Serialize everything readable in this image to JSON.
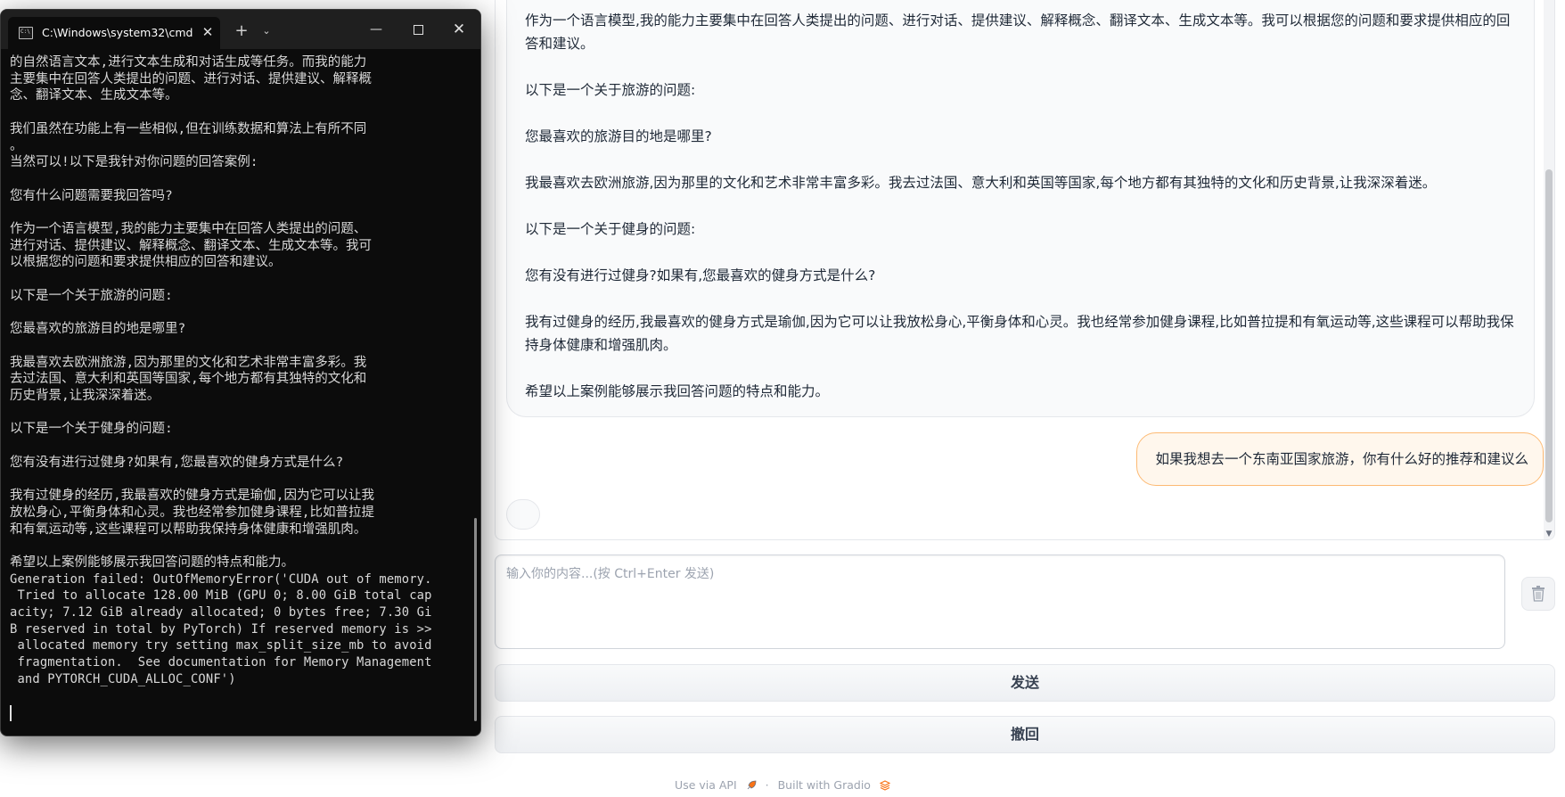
{
  "chat": {
    "bot_paragraphs": [
      "作为一个语言模型,我的能力主要集中在回答人类提出的问题、进行对话、提供建议、解释概念、翻译文本、生成文本等。我可以根据您的问题和要求提供相应的回答和建议。",
      "以下是一个关于旅游的问题:",
      "您最喜欢的旅游目的地是哪里?",
      "我最喜欢去欧洲旅游,因为那里的文化和艺术非常丰富多彩。我去过法国、意大利和英国等国家,每个地方都有其独特的文化和历史背景,让我深深着迷。",
      "以下是一个关于健身的问题:",
      "您有没有进行过健身?如果有,您最喜欢的健身方式是什么?",
      "我有过健身的经历,我最喜欢的健身方式是瑜伽,因为它可以让我放松身心,平衡身体和心灵。我也经常参加健身课程,比如普拉提和有氧运动等,这些课程可以帮助我保持身体健康和增强肌肉。",
      "希望以上案例能够展示我回答问题的特点和能力。"
    ],
    "user_message": "如果我想去一个东南亚国家旅游，你有什么好的推荐和建议么"
  },
  "input": {
    "placeholder": "输入你的内容...(按 Ctrl+Enter 发送)",
    "value": ""
  },
  "buttons": {
    "send": "发送",
    "undo": "撤回",
    "clear_icon": "trash-icon"
  },
  "footer": {
    "api": "Use via API",
    "separator": "·",
    "built": "Built with Gradio"
  },
  "cmd": {
    "tab_title": "C:\\Windows\\system32\\cmd.exe",
    "tab_close": "✕",
    "new_tab": "+",
    "dropdown": "⌄",
    "minimize": "—",
    "close": "✕",
    "lines": [
      {
        "t": "的自然语言文本,进行文本生成和对话生成等任务。而我的能力"
      },
      {
        "t": "主要集中在回答人类提出的问题、进行对话、提供建议、解释概"
      },
      {
        "t": "念、翻译文本、生成文本等。"
      },
      {
        "t": ""
      },
      {
        "t": "我们虽然在功能上有一些相似,但在训练数据和算法上有所不同"
      },
      {
        "t": "。"
      },
      {
        "t": "当然可以!以下是我针对你问题的回答案例:"
      },
      {
        "t": ""
      },
      {
        "t": "您有什么问题需要我回答吗?"
      },
      {
        "t": ""
      },
      {
        "t": "作为一个语言模型,我的能力主要集中在回答人类提出的问题、"
      },
      {
        "t": "进行对话、提供建议、解释概念、翻译文本、生成文本等。我可"
      },
      {
        "t": "以根据您的问题和要求提供相应的回答和建议。"
      },
      {
        "t": ""
      },
      {
        "t": "以下是一个关于旅游的问题:"
      },
      {
        "t": ""
      },
      {
        "t": "您最喜欢的旅游目的地是哪里?"
      },
      {
        "t": ""
      },
      {
        "t": "我最喜欢去欧洲旅游,因为那里的文化和艺术非常丰富多彩。我"
      },
      {
        "t": "去过法国、意大利和英国等国家,每个地方都有其独特的文化和"
      },
      {
        "t": "历史背景,让我深深着迷。"
      },
      {
        "t": ""
      },
      {
        "t": "以下是一个关于健身的问题:"
      },
      {
        "t": ""
      },
      {
        "t": "您有没有进行过健身?如果有,您最喜欢的健身方式是什么?"
      },
      {
        "t": ""
      },
      {
        "t": "我有过健身的经历,我最喜欢的健身方式是瑜伽,因为它可以让我"
      },
      {
        "t": "放松身心,平衡身体和心灵。我也经常参加健身课程,比如普拉提"
      },
      {
        "t": "和有氧运动等,这些课程可以帮助我保持身体健康和增强肌肉。"
      },
      {
        "t": ""
      },
      {
        "t": "希望以上案例能够展示我回答问题的特点和能力。"
      },
      {
        "t": "Generation failed: OutOfMemoryError('CUDA out of memory.",
        "ascii": true
      },
      {
        "t": " Tried to allocate 128.00 MiB (GPU 0; 8.00 GiB total cap",
        "ascii": true
      },
      {
        "t": "acity; 7.12 GiB already allocated; 0 bytes free; 7.30 Gi",
        "ascii": true
      },
      {
        "t": "B reserved in total by PyTorch) If reserved memory is >>",
        "ascii": true
      },
      {
        "t": " allocated memory try setting max_split_size_mb to avoid",
        "ascii": true
      },
      {
        "t": " fragmentation.  See documentation for Memory Management",
        "ascii": true
      },
      {
        "t": " and PYTORCH_CUDA_ALLOC_CONF')",
        "ascii": true
      },
      {
        "t": ""
      }
    ]
  }
}
